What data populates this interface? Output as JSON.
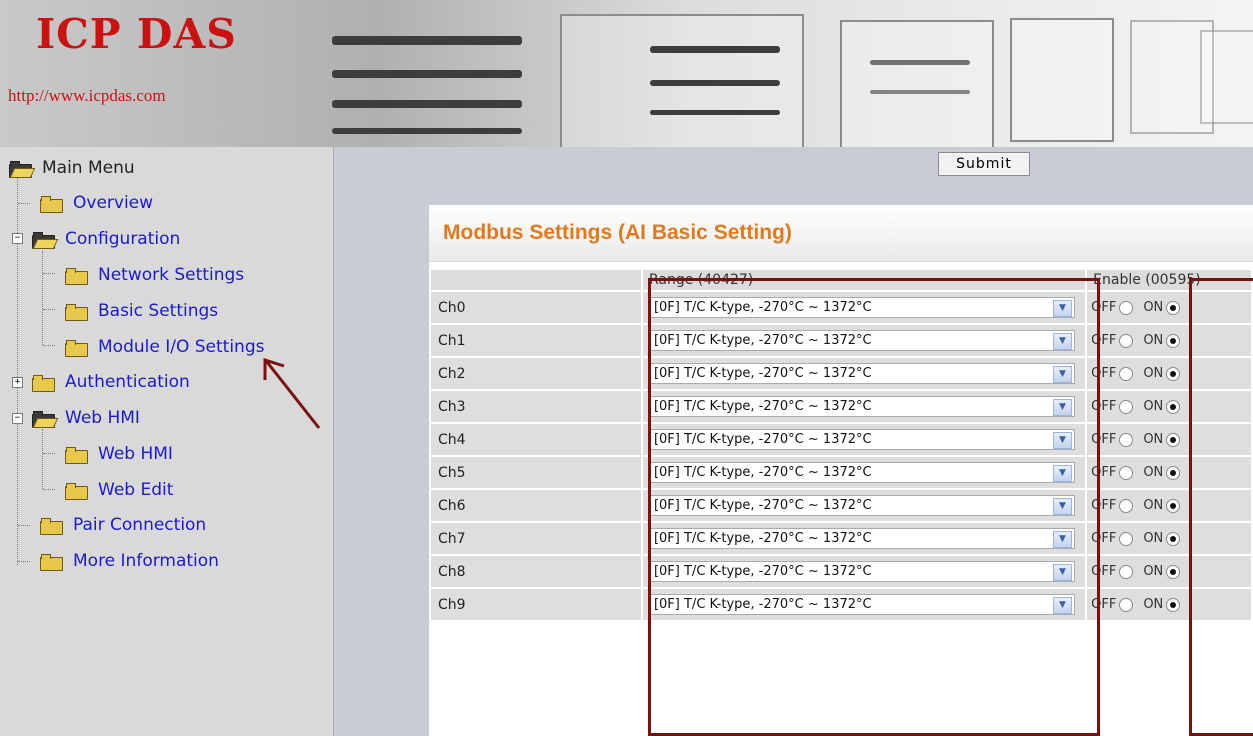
{
  "header": {
    "logo": "ICP DAS",
    "url": "http://www.icpdas.com"
  },
  "sidebar": {
    "root_label": "Main Menu",
    "items": [
      {
        "label": "Overview"
      },
      {
        "label": "Configuration"
      },
      {
        "label": "Network Settings"
      },
      {
        "label": "Basic Settings"
      },
      {
        "label": "Module I/O Settings"
      },
      {
        "label": "Authentication"
      },
      {
        "label": "Web HMI"
      },
      {
        "label": "Web HMI"
      },
      {
        "label": "Web Edit"
      },
      {
        "label": "Pair Connection"
      },
      {
        "label": "More Information"
      }
    ],
    "expanders": {
      "configuration": "−",
      "authentication": "+",
      "web_hmi": "−"
    }
  },
  "main": {
    "submit_label": "Submit",
    "card_title": "Modbus Settings (AI Basic Setting)",
    "headers": {
      "range": "Range (40427)",
      "enable": "Enable (00595)"
    },
    "radio_labels": {
      "off": "OFF",
      "on": "ON"
    },
    "channels": [
      {
        "name": "Ch0",
        "range": "[0F] T/C K-type, -270°C ~ 1372°C",
        "enabled": true
      },
      {
        "name": "Ch1",
        "range": "[0F] T/C K-type, -270°C ~ 1372°C",
        "enabled": true
      },
      {
        "name": "Ch2",
        "range": "[0F] T/C K-type, -270°C ~ 1372°C",
        "enabled": true
      },
      {
        "name": "Ch3",
        "range": "[0F] T/C K-type, -270°C ~ 1372°C",
        "enabled": true
      },
      {
        "name": "Ch4",
        "range": "[0F] T/C K-type, -270°C ~ 1372°C",
        "enabled": true
      },
      {
        "name": "Ch5",
        "range": "[0F] T/C K-type, -270°C ~ 1372°C",
        "enabled": true
      },
      {
        "name": "Ch6",
        "range": "[0F] T/C K-type, -270°C ~ 1372°C",
        "enabled": true
      },
      {
        "name": "Ch7",
        "range": "[0F] T/C K-type, -270°C ~ 1372°C",
        "enabled": true
      },
      {
        "name": "Ch8",
        "range": "[0F] T/C K-type, -270°C ~ 1372°C",
        "enabled": true
      },
      {
        "name": "Ch9",
        "range": "[0F] T/C K-type, -270°C ~ 1372°C",
        "enabled": true
      }
    ]
  },
  "colors": {
    "accent": "#e07a1f",
    "logo": "#cc1111",
    "link": "#1a1ad0",
    "highlight": "#7a1010"
  }
}
